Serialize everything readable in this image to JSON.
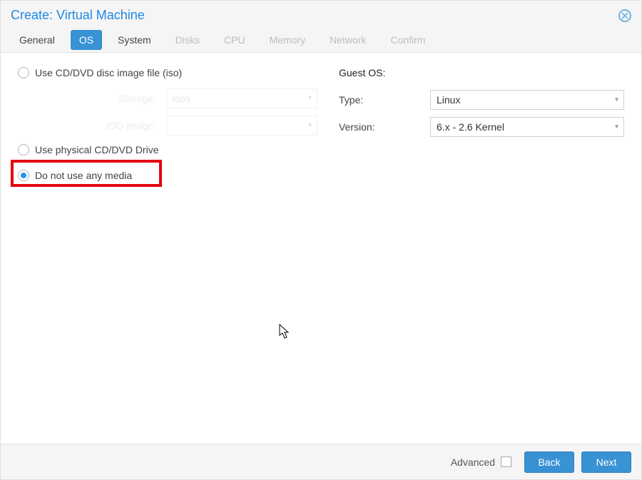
{
  "window": {
    "title": "Create: Virtual Machine"
  },
  "tabs": {
    "general": "General",
    "os": "OS",
    "system": "System",
    "disks": "Disks",
    "cpu": "CPU",
    "memory": "Memory",
    "network": "Network",
    "confirm": "Confirm"
  },
  "media": {
    "opt_iso": "Use CD/DVD disc image file (iso)",
    "storage_label": "Storage:",
    "storage_value": "isos",
    "iso_label": "ISO image:",
    "iso_value": "",
    "opt_physical": "Use physical CD/DVD Drive",
    "opt_none": "Do not use any media"
  },
  "guest_os": {
    "header": "Guest OS:",
    "type_label": "Type:",
    "type_value": "Linux",
    "version_label": "Version:",
    "version_value": "6.x - 2.6 Kernel"
  },
  "footer": {
    "advanced": "Advanced",
    "back": "Back",
    "next": "Next"
  }
}
